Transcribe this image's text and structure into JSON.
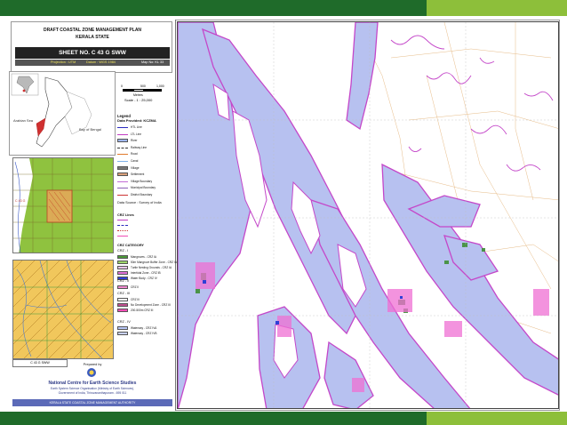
{
  "header": {
    "plan_title": "DRAFT COASTAL ZONE MANAGEMENT PLAN",
    "state": "KERALA STATE",
    "sheet_no": "SHEET NO. C 43 G SWW",
    "projection": "Projection : UTM",
    "datum": "Datum : WGS 1984",
    "map_no": "Map No: KL 33"
  },
  "locator": {
    "sea_label_1": "Arabian Sea",
    "sea_label_2": "Bay of Bengal"
  },
  "scale": {
    "ticks": [
      "0",
      "500",
      "1,000"
    ],
    "unit": "Metres",
    "ratio": "Scale - 1 : 25,000"
  },
  "legend": {
    "title": "Legend",
    "subtitle": "Data Provided: KCZMA",
    "source": "Data Source : Survey of India",
    "crz_lines_head": "CRZ Lines",
    "crz_category_head": "CRZ CATEGORY",
    "items_top": [
      {
        "label": "HTL Line",
        "color": "#2b2bbf",
        "kind": "line"
      },
      {
        "label": "LTL Line",
        "color": "#c23bc2",
        "kind": "line"
      },
      {
        "label": "River",
        "color": "#9fb6f2",
        "kind": "fill"
      },
      {
        "label": "Railway Line",
        "color": "#333333",
        "kind": "rail"
      },
      {
        "label": "Road",
        "color": "#e07a2b",
        "kind": "line"
      },
      {
        "label": "Canal",
        "color": "#7fb1e8",
        "kind": "line"
      },
      {
        "label": "Village",
        "color": "#7a7a7a",
        "kind": "fill"
      },
      {
        "label": "Settlement",
        "color": "#d9a07a",
        "kind": "fill"
      },
      {
        "label": "Village Boundary",
        "color": "#c26bd6",
        "kind": "line"
      },
      {
        "label": "Municipal Boundary",
        "color": "#8a5fb5",
        "kind": "line"
      },
      {
        "label": "District Boundary",
        "color": "#cc3333",
        "kind": "line"
      }
    ],
    "items_crz": [
      {
        "label": "Mangroves - CRZ IA",
        "color": "#4c9a3a"
      },
      {
        "label": "50m Mangrove Buffer Zone - CRZ IA",
        "color": "#9cd46a"
      },
      {
        "label": "Turtle Nesting Grounds - CRZ IA",
        "color": "#e6c3e8"
      },
      {
        "label": "Intertidal Zone - CRZ IB",
        "color": "#e070d8"
      },
      {
        "label": "Water Body - CRZ IV",
        "color": "#2f3fd6"
      },
      {
        "label": "CRZ II",
        "color": "#f08ad0"
      },
      {
        "label": "CRZ III",
        "color": "#ffffff"
      },
      {
        "label": "No Development Zone - CRZ III",
        "color": "#c05090"
      },
      {
        "label": "200-500m CRZ III",
        "color": "#ef4db4"
      },
      {
        "label": "Waterway - CRZ IVA",
        "color": "#b7c6f5"
      },
      {
        "label": "Waterway - CRZ IVB",
        "color": "#c8d0f0"
      }
    ],
    "crz_i_head": "CRZ - I",
    "crz_ii_head": "CRZ - II",
    "crz_iii_head": "CRZ - III",
    "crz_iv_head": "CRZ - IV"
  },
  "index_maps": {
    "index1_label": "C 43 G",
    "index2_label": "C 43 G SWW"
  },
  "prepared_by": {
    "label": "Prepared by",
    "institution": "National Centre for Earth Science Studies",
    "line2": "Earth System Science Organisation (Ministry of Earth Sciences),",
    "line3": "Government of India, Thiruvananthapuram - 695 011",
    "authority": "KERALA STATE COASTAL ZONE MANAGEMENT AUTHORITY"
  },
  "colors": {
    "bar_dark": "#1f6b2a",
    "bar_light": "#8dbf3a",
    "water": "#b7c1f0",
    "crz_pink": "#d34fd0",
    "road": "#e1a36a"
  }
}
